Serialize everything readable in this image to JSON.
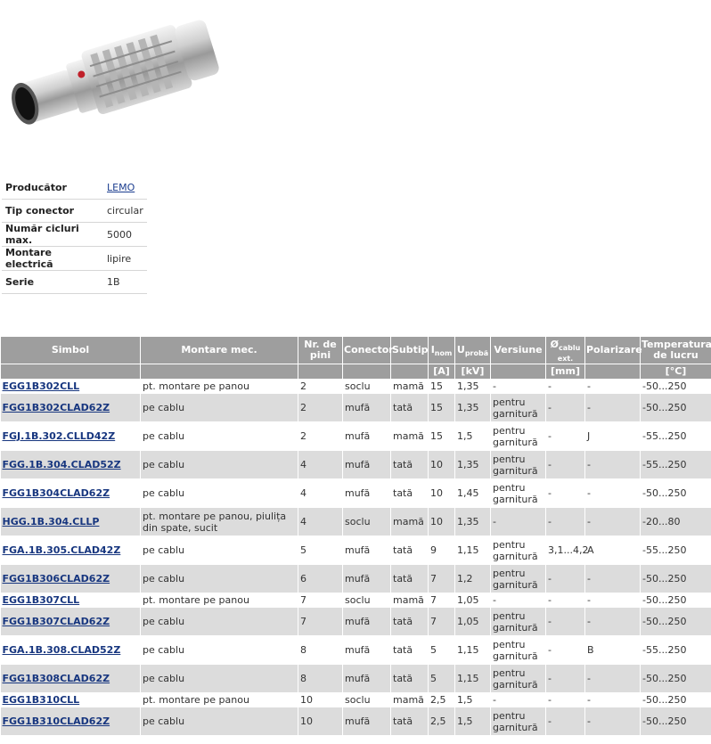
{
  "properties": [
    {
      "label": "Producător",
      "value": "LEMO",
      "link": true
    },
    {
      "label": "Tip conector",
      "value": "circular",
      "link": false
    },
    {
      "label": "Număr cicluri max.",
      "value": "5000",
      "link": false
    },
    {
      "label": "Montare electrică",
      "value": "lipire",
      "link": false
    },
    {
      "label": "Serie",
      "value": "1B",
      "link": false
    }
  ],
  "table": {
    "headers": {
      "simbol": "Simbol",
      "montare": "Montare mec.",
      "pini": "Nr. de pini",
      "conector": "Conector",
      "subtip": "Subtip",
      "inom_main": "I",
      "inom_sub": "nom",
      "uproba_main": "U",
      "uproba_sub": "probă",
      "versiune": "Versiune",
      "cablu_main": "Ø",
      "cablu_sub": "cablu ext.",
      "polarizare": "Polarizare",
      "temperatura": "Temperatura de lucru"
    },
    "units": {
      "inom": "[A]",
      "uproba": "[kV]",
      "cablu": "[mm]",
      "temperatura": "[°C]"
    },
    "rows": [
      {
        "simbol": "EGG1B302CLL",
        "montare": "pt. montare pe panou",
        "pini": "2",
        "conector": "soclu",
        "subtip": "mamă",
        "inom": "15",
        "uproba": "1,35",
        "versiune": "-",
        "cablu": "-",
        "polarizare": "-",
        "temperatura": "-50...250"
      },
      {
        "simbol": "FGG1B302CLAD62Z",
        "montare": "pe cablu",
        "pini": "2",
        "conector": "mufă",
        "subtip": "tată",
        "inom": "15",
        "uproba": "1,35",
        "versiune": "pentru garnitură",
        "cablu": "-",
        "polarizare": "-",
        "temperatura": "-50...250"
      },
      {
        "simbol": "FGJ.1B.302.CLLD42Z",
        "montare": "pe cablu",
        "pini": "2",
        "conector": "mufă",
        "subtip": "mamă",
        "inom": "15",
        "uproba": "1,5",
        "versiune": "pentru garnitură",
        "cablu": "-",
        "polarizare": "J",
        "temperatura": "-55...250"
      },
      {
        "simbol": "FGG.1B.304.CLAD52Z",
        "montare": "pe cablu",
        "pini": "4",
        "conector": "mufă",
        "subtip": "tată",
        "inom": "10",
        "uproba": "1,35",
        "versiune": "pentru garnitură",
        "cablu": "-",
        "polarizare": "-",
        "temperatura": "-55...250"
      },
      {
        "simbol": "FGG1B304CLAD62Z",
        "montare": "pe cablu",
        "pini": "4",
        "conector": "mufă",
        "subtip": "tată",
        "inom": "10",
        "uproba": "1,45",
        "versiune": "pentru garnitură",
        "cablu": "-",
        "polarizare": "-",
        "temperatura": "-50...250"
      },
      {
        "simbol": "HGG.1B.304.CLLP",
        "montare": "pt. montare pe panou, piulița din spate, sucit",
        "pini": "4",
        "conector": "soclu",
        "subtip": "mamă",
        "inom": "10",
        "uproba": "1,35",
        "versiune": "-",
        "cablu": "-",
        "polarizare": "-",
        "temperatura": "-20...80"
      },
      {
        "simbol": "FGA.1B.305.CLAD42Z",
        "montare": "pe cablu",
        "pini": "5",
        "conector": "mufă",
        "subtip": "tată",
        "inom": "9",
        "uproba": "1,15",
        "versiune": "pentru garnitură",
        "cablu": "3,1...4,2",
        "polarizare": "A",
        "temperatura": "-55...250"
      },
      {
        "simbol": "FGG1B306CLAD62Z",
        "montare": "pe cablu",
        "pini": "6",
        "conector": "mufă",
        "subtip": "tată",
        "inom": "7",
        "uproba": "1,2",
        "versiune": "pentru garnitură",
        "cablu": "-",
        "polarizare": "-",
        "temperatura": "-50...250"
      },
      {
        "simbol": "EGG1B307CLL",
        "montare": "pt. montare pe panou",
        "pini": "7",
        "conector": "soclu",
        "subtip": "mamă",
        "inom": "7",
        "uproba": "1,05",
        "versiune": "-",
        "cablu": "-",
        "polarizare": "-",
        "temperatura": "-50...250"
      },
      {
        "simbol": "FGG1B307CLAD62Z",
        "montare": "pe cablu",
        "pini": "7",
        "conector": "mufă",
        "subtip": "tată",
        "inom": "7",
        "uproba": "1,05",
        "versiune": "pentru garnitură",
        "cablu": "-",
        "polarizare": "-",
        "temperatura": "-50...250"
      },
      {
        "simbol": "FGA.1B.308.CLAD52Z",
        "montare": "pe cablu",
        "pini": "8",
        "conector": "mufă",
        "subtip": "tată",
        "inom": "5",
        "uproba": "1,15",
        "versiune": "pentru garnitură",
        "cablu": "-",
        "polarizare": "B",
        "temperatura": "-55...250"
      },
      {
        "simbol": "FGG1B308CLAD62Z",
        "montare": "pe cablu",
        "pini": "8",
        "conector": "mufă",
        "subtip": "tată",
        "inom": "5",
        "uproba": "1,15",
        "versiune": "pentru garnitură",
        "cablu": "-",
        "polarizare": "-",
        "temperatura": "-50...250"
      },
      {
        "simbol": "EGG1B310CLL",
        "montare": "pt. montare pe panou",
        "pini": "10",
        "conector": "soclu",
        "subtip": "mamă",
        "inom": "2,5",
        "uproba": "1,5",
        "versiune": "-",
        "cablu": "-",
        "polarizare": "-",
        "temperatura": "-50...250"
      },
      {
        "simbol": "FGG1B310CLAD62Z",
        "montare": "pe cablu",
        "pini": "10",
        "conector": "mufă",
        "subtip": "tată",
        "inom": "2,5",
        "uproba": "1,5",
        "versiune": "pentru garnitură",
        "cablu": "-",
        "polarizare": "-",
        "temperatura": "-50...250"
      }
    ]
  }
}
